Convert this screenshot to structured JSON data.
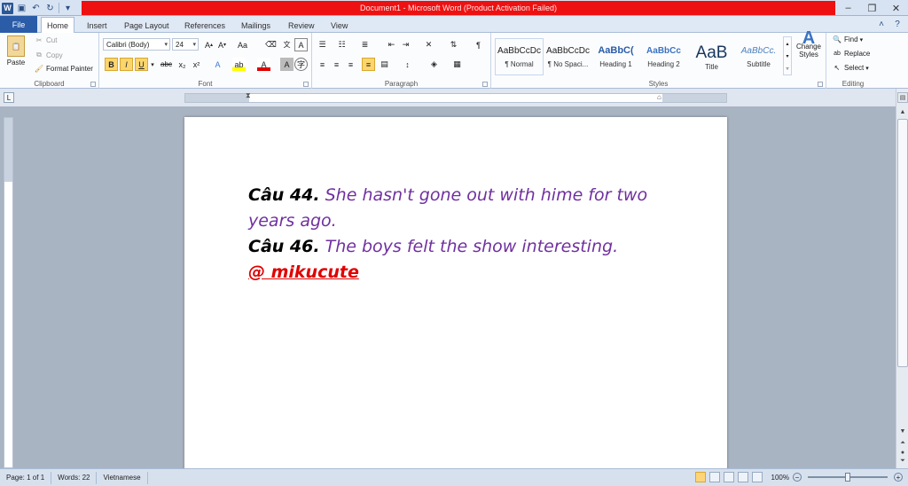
{
  "window": {
    "title": "Document1 - Microsoft Word (Product Activation Failed)",
    "app_icon": "W",
    "controls": [
      "minimize-icon",
      "restore-icon",
      "close-icon"
    ]
  },
  "tabs": [
    "File",
    "Home",
    "Insert",
    "Page Layout",
    "References",
    "Mailings",
    "Review",
    "View"
  ],
  "ribbon": {
    "clipboard": {
      "label": "Clipboard",
      "paste": "Paste",
      "cut": "Cut",
      "copy": "Copy",
      "format_painter": "Format Painter"
    },
    "font": {
      "label": "Font",
      "font_name": "Calibri (Body)",
      "font_size": "24",
      "bold": "B",
      "italic": "I",
      "underline": "U",
      "strike": "abc",
      "subscript": "x₂",
      "superscript": "x²",
      "case": "Aa"
    },
    "paragraph": {
      "label": "Paragraph"
    },
    "styles": {
      "label": "Styles",
      "items": [
        {
          "sample": "AaBbCcDc",
          "name": "¶ Normal"
        },
        {
          "sample": "AaBbCcDc",
          "name": "¶ No Spaci..."
        },
        {
          "sample": "AaBbC(",
          "name": "Heading 1"
        },
        {
          "sample": "AaBbCc",
          "name": "Heading 2"
        },
        {
          "sample": "AaB",
          "name": "Title"
        },
        {
          "sample": "AaBbCc.",
          "name": "Subtitle"
        }
      ],
      "change_styles": "Change Styles"
    },
    "editing": {
      "label": "Editing",
      "find": "Find",
      "replace": "Replace",
      "select": "Select"
    }
  },
  "document": {
    "q1_label": "Câu 44.",
    "q1_text_a": " She hasn't gone out with hime for two",
    "q1_text_b": "years ago.",
    "q2_label": "Câu 46.",
    "q2_text": " The boys felt the show interesting.",
    "signature": "@ mikucute"
  },
  "status": {
    "page": "Page: 1 of 1",
    "words": "Words: 22",
    "language": "Vietnamese",
    "zoom": "100%"
  },
  "colors": {
    "title_bar_accent": "#ee1111",
    "file_tab": "#2a5ca8",
    "body_text": "#7030a0",
    "signature": "#e00000"
  }
}
